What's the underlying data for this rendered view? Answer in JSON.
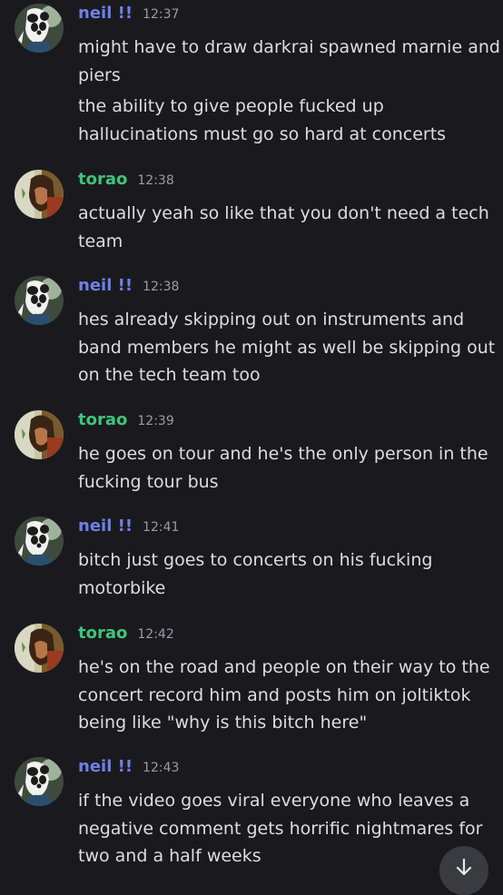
{
  "colors": {
    "background": "#1a1a1e",
    "text": "#dcdde0",
    "timestamp": "#9a9ca3",
    "neil_name": "#6d80e8",
    "torao_name": "#3ec57a"
  },
  "messages": [
    {
      "author": "neil !!",
      "author_color": "#6d80e8",
      "avatar_icon": "panda-avatar",
      "time": "12:37",
      "paragraphs": [
        [
          "might have to draw darkrai spawned marnie and",
          "piers"
        ],
        [
          "the ability to give people fucked up",
          "hallucinations must go so hard at concerts"
        ]
      ]
    },
    {
      "author": "torao",
      "author_color": "#3ec57a",
      "avatar_icon": "person-avatar",
      "time": "12:38",
      "paragraphs": [
        [
          "actually yeah so like that you don't need a tech",
          "team"
        ]
      ]
    },
    {
      "author": "neil !!",
      "author_color": "#6d80e8",
      "avatar_icon": "panda-avatar",
      "time": "12:38",
      "paragraphs": [
        [
          "hes already skipping out on instruments and",
          "band members he might as well be skipping out",
          "on the tech team too"
        ]
      ]
    },
    {
      "author": "torao",
      "author_color": "#3ec57a",
      "avatar_icon": "person-avatar",
      "time": "12:39",
      "paragraphs": [
        [
          "he goes on tour and he's the only person in the",
          "fucking tour bus"
        ]
      ]
    },
    {
      "author": "neil !!",
      "author_color": "#6d80e8",
      "avatar_icon": "panda-avatar",
      "time": "12:41",
      "paragraphs": [
        [
          "bitch just goes to concerts on his fucking",
          "motorbike"
        ]
      ]
    },
    {
      "author": "torao",
      "author_color": "#3ec57a",
      "avatar_icon": "person-avatar",
      "time": "12:42",
      "paragraphs": [
        [
          "he's on the road and people on their way to the",
          "concert record him and posts him on joltiktok",
          "being like \"why is this bitch here\""
        ]
      ]
    },
    {
      "author": "neil !!",
      "author_color": "#6d80e8",
      "avatar_icon": "panda-avatar",
      "time": "12:43",
      "paragraphs": [
        [
          "if the video goes viral everyone who leaves a",
          "negative comment gets horrific nightmares for",
          "two and a half weeks"
        ]
      ]
    }
  ],
  "jump_button": {
    "icon": "arrow-down-icon"
  }
}
